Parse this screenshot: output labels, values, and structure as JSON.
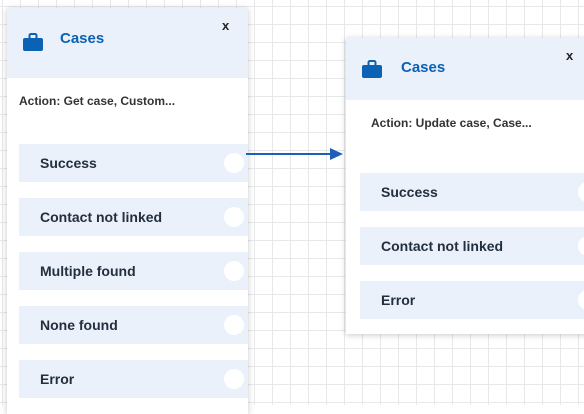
{
  "colors": {
    "accent": "#0b62b4",
    "header_bg": "#eaf1fb",
    "arrow": "#1f5fb8",
    "grid": "#e6e8ea"
  },
  "block1": {
    "icon": "briefcase-icon",
    "title": "Cases",
    "close_label": "x",
    "action": "Action: Get case, Custom...",
    "branches": [
      {
        "label": "Success"
      },
      {
        "label": "Contact not linked"
      },
      {
        "label": "Multiple found"
      },
      {
        "label": "None found"
      },
      {
        "label": "Error"
      }
    ]
  },
  "block2": {
    "icon": "briefcase-icon",
    "title": "Cases",
    "close_label": "x",
    "action": "Action: Update case, Case...",
    "branches": [
      {
        "label": "Success"
      },
      {
        "label": "Contact not linked"
      },
      {
        "label": "Error"
      }
    ]
  }
}
